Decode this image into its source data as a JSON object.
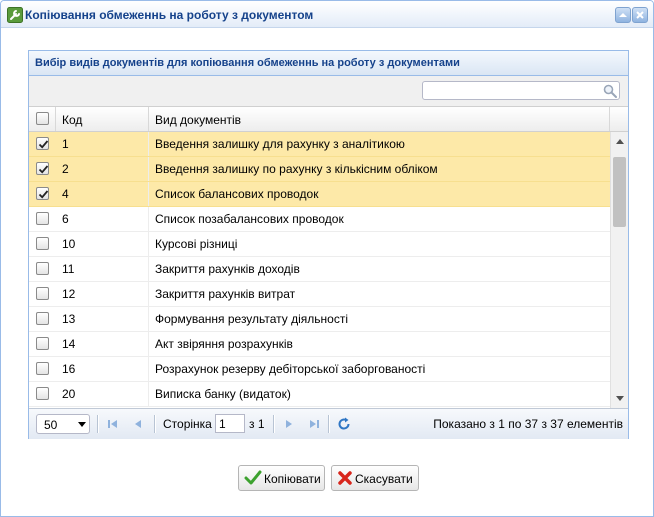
{
  "window": {
    "title": "Копіювання обмеженнь на роботу з документом"
  },
  "panel": {
    "title": "Вибір видів документів для копіювання обмеженнь на роботу з документами",
    "search": {
      "value": "",
      "placeholder": ""
    }
  },
  "grid": {
    "columns": {
      "code": "Код",
      "type": "Вид документів"
    },
    "rows": [
      {
        "code": "1",
        "type": "Введення залишку для рахунку з аналітикою",
        "checked": true
      },
      {
        "code": "2",
        "type": "Введення залишку по рахунку з кількісним обліком",
        "checked": true
      },
      {
        "code": "4",
        "type": "Список балансових проводок",
        "checked": true
      },
      {
        "code": "6",
        "type": "Список позабалансових проводок",
        "checked": false
      },
      {
        "code": "10",
        "type": "Курсові різниці",
        "checked": false
      },
      {
        "code": "11",
        "type": "Закриття рахунків доходів",
        "checked": false
      },
      {
        "code": "12",
        "type": "Закриття рахунків витрат",
        "checked": false
      },
      {
        "code": "13",
        "type": "Формування результату діяльності",
        "checked": false
      },
      {
        "code": "14",
        "type": "Акт звіряння розрахунків",
        "checked": false
      },
      {
        "code": "16",
        "type": "Розрахунок резерву дебіторської заборгованості",
        "checked": false
      },
      {
        "code": "20",
        "type": "Виписка банку (видаток)",
        "checked": false
      }
    ]
  },
  "pager": {
    "page_size": "50",
    "page_label": "Сторінка",
    "page_value": "1",
    "of_label": "з 1",
    "info": "Показано з 1 по 37 з 37 елементів"
  },
  "buttons": {
    "copy": "Копіювати",
    "cancel": "Скасувати"
  },
  "colors": {
    "selected_row": "#fde9a8",
    "title_text": "#15428b",
    "border": "#99bbe8"
  },
  "icons": {
    "title": "wrench-icon",
    "copy": "green-check-icon",
    "cancel": "red-x-icon",
    "refresh": "refresh-icon",
    "search": "magnifier-icon"
  }
}
